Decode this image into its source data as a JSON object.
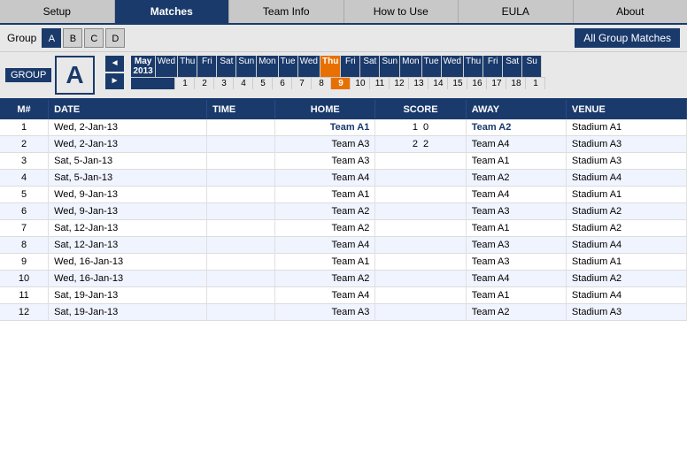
{
  "nav": {
    "tabs": [
      {
        "label": "Setup",
        "active": false
      },
      {
        "label": "Matches",
        "active": true
      },
      {
        "label": "Team Info",
        "active": false
      },
      {
        "label": "How to Use",
        "active": false
      },
      {
        "label": "EULA",
        "active": false
      },
      {
        "label": "About",
        "active": false
      }
    ]
  },
  "groupRow": {
    "label": "Group",
    "groups": [
      "A",
      "B",
      "C",
      "D"
    ],
    "activeGroup": "A",
    "allGroupMatchesLabel": "All Group Matches"
  },
  "calendar": {
    "month": "May",
    "year": "2013",
    "days": [
      "Wed",
      "Thu",
      "Fri",
      "Sat",
      "Sun",
      "Mon",
      "Tue",
      "Wed",
      "Thu",
      "Fri",
      "Sat",
      "Sun",
      "Mon",
      "Tue",
      "Wed",
      "Thu",
      "Fri",
      "Sat",
      "Su"
    ],
    "nums": [
      "1",
      "2",
      "3",
      "4",
      "5",
      "6",
      "7",
      "8",
      "9",
      "10",
      "11",
      "12",
      "13",
      "14",
      "15",
      "16",
      "17",
      "18",
      "1"
    ],
    "highlightIndex": 8
  },
  "groupNav": {
    "label": "GROUP",
    "letter": "A",
    "prevArrow": "◄",
    "nextArrow": "►"
  },
  "table": {
    "columns": [
      "M#",
      "DATE",
      "TIME",
      "HOME",
      "SCORE",
      "AWAY",
      "VENUE"
    ],
    "rows": [
      {
        "m": "1",
        "date": "Wed, 2-Jan-13",
        "time": "",
        "home": "Team A1",
        "homeBlue": true,
        "score1": "1",
        "score2": "0",
        "away": "Team A2",
        "awayBlue": true,
        "venue": "Stadium A1"
      },
      {
        "m": "2",
        "date": "Wed, 2-Jan-13",
        "time": "",
        "home": "Team A3",
        "homeBlue": false,
        "score1": "2",
        "score2": "2",
        "away": "Team A4",
        "awayBlue": false,
        "venue": "Stadium A3"
      },
      {
        "m": "3",
        "date": "Sat, 5-Jan-13",
        "time": "",
        "home": "Team A3",
        "homeBlue": false,
        "score1": "",
        "score2": "",
        "away": "Team A1",
        "awayBlue": false,
        "venue": "Stadium A3"
      },
      {
        "m": "4",
        "date": "Sat, 5-Jan-13",
        "time": "",
        "home": "Team A4",
        "homeBlue": false,
        "score1": "",
        "score2": "",
        "away": "Team A2",
        "awayBlue": false,
        "venue": "Stadium A4"
      },
      {
        "m": "5",
        "date": "Wed, 9-Jan-13",
        "time": "",
        "home": "Team A1",
        "homeBlue": false,
        "score1": "",
        "score2": "",
        "away": "Team A4",
        "awayBlue": false,
        "venue": "Stadium A1"
      },
      {
        "m": "6",
        "date": "Wed, 9-Jan-13",
        "time": "",
        "home": "Team A2",
        "homeBlue": false,
        "score1": "",
        "score2": "",
        "away": "Team A3",
        "awayBlue": false,
        "venue": "Stadium A2"
      },
      {
        "m": "7",
        "date": "Sat, 12-Jan-13",
        "time": "",
        "home": "Team A2",
        "homeBlue": false,
        "score1": "",
        "score2": "",
        "away": "Team A1",
        "awayBlue": false,
        "venue": "Stadium A2"
      },
      {
        "m": "8",
        "date": "Sat, 12-Jan-13",
        "time": "",
        "home": "Team A4",
        "homeBlue": false,
        "score1": "",
        "score2": "",
        "away": "Team A3",
        "awayBlue": false,
        "venue": "Stadium A4"
      },
      {
        "m": "9",
        "date": "Wed, 16-Jan-13",
        "time": "",
        "home": "Team A1",
        "homeBlue": false,
        "score1": "",
        "score2": "",
        "away": "Team A3",
        "awayBlue": false,
        "venue": "Stadium A1"
      },
      {
        "m": "10",
        "date": "Wed, 16-Jan-13",
        "time": "",
        "home": "Team A2",
        "homeBlue": false,
        "score1": "",
        "score2": "",
        "away": "Team A4",
        "awayBlue": false,
        "venue": "Stadium A2"
      },
      {
        "m": "11",
        "date": "Sat, 19-Jan-13",
        "time": "",
        "home": "Team A4",
        "homeBlue": false,
        "score1": "",
        "score2": "",
        "away": "Team A1",
        "awayBlue": false,
        "venue": "Stadium A4"
      },
      {
        "m": "12",
        "date": "Sat, 19-Jan-13",
        "time": "",
        "home": "Team A3",
        "homeBlue": false,
        "score1": "",
        "score2": "",
        "away": "Team A2",
        "awayBlue": false,
        "venue": "Stadium A3"
      }
    ]
  }
}
